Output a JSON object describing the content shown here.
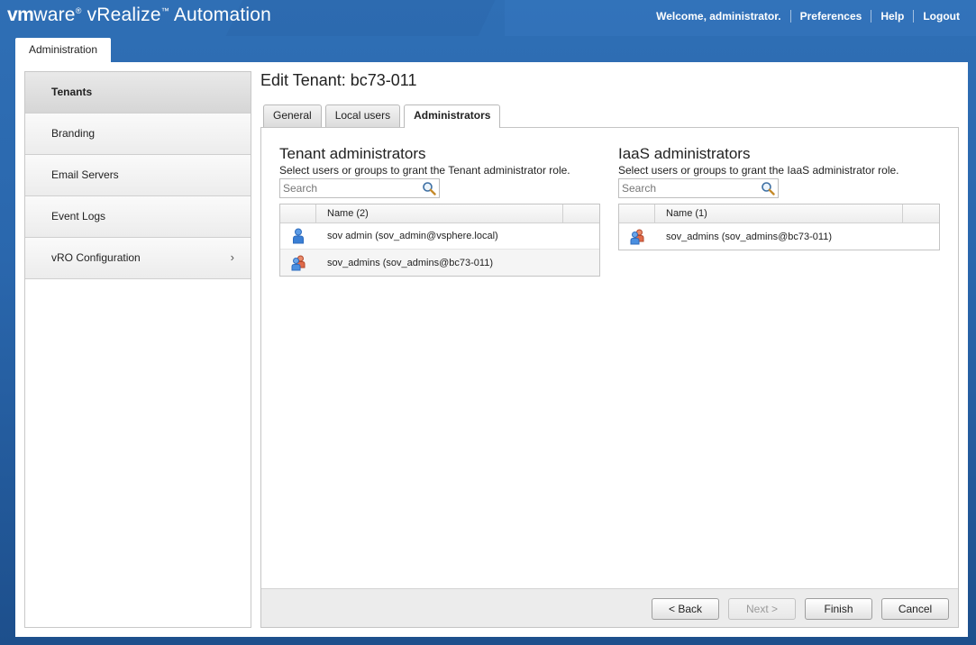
{
  "header": {
    "brand_vm": "vm",
    "brand_ware": "ware",
    "brand_reg": "®",
    "product": "vRealize",
    "product_tm": "™",
    "product_suffix": "Automation",
    "welcome": "Welcome, administrator.",
    "preferences": "Preferences",
    "help": "Help",
    "logout": "Logout"
  },
  "app_tab": "Administration",
  "sidebar": {
    "items": [
      {
        "label": "Tenants"
      },
      {
        "label": "Branding"
      },
      {
        "label": "Email Servers"
      },
      {
        "label": "Event Logs"
      },
      {
        "label": "vRO Configuration",
        "chevron": "›"
      }
    ]
  },
  "page": {
    "title": "Edit Tenant: bc73-011",
    "tabs": [
      {
        "label": "General"
      },
      {
        "label": "Local users"
      },
      {
        "label": "Administrators"
      }
    ]
  },
  "tenant_admins": {
    "title": "Tenant administrators",
    "description": "Select users or groups to grant the Tenant administrator role.",
    "search_placeholder": "Search",
    "column": "Name (2)",
    "rows": [
      {
        "name": "sov admin (sov_admin@vsphere.local)",
        "icon": "user-icon"
      },
      {
        "name": "sov_admins (sov_admins@bc73-011)",
        "icon": "group-icon"
      }
    ]
  },
  "iaas_admins": {
    "title": "IaaS administrators",
    "description": "Select users or groups to grant the IaaS administrator role.",
    "search_placeholder": "Search",
    "column": "Name (1)",
    "rows": [
      {
        "name": "sov_admins (sov_admins@bc73-011)",
        "icon": "group-icon"
      }
    ]
  },
  "footer": {
    "back": "< Back",
    "next": "Next >",
    "finish": "Finish",
    "cancel": "Cancel"
  },
  "colors": {
    "accent_blue": "#2a67ad",
    "user_icon": "#3a7fd5",
    "group_icon_front": "#4a8fe0",
    "group_icon_back": "#e06a4a"
  }
}
